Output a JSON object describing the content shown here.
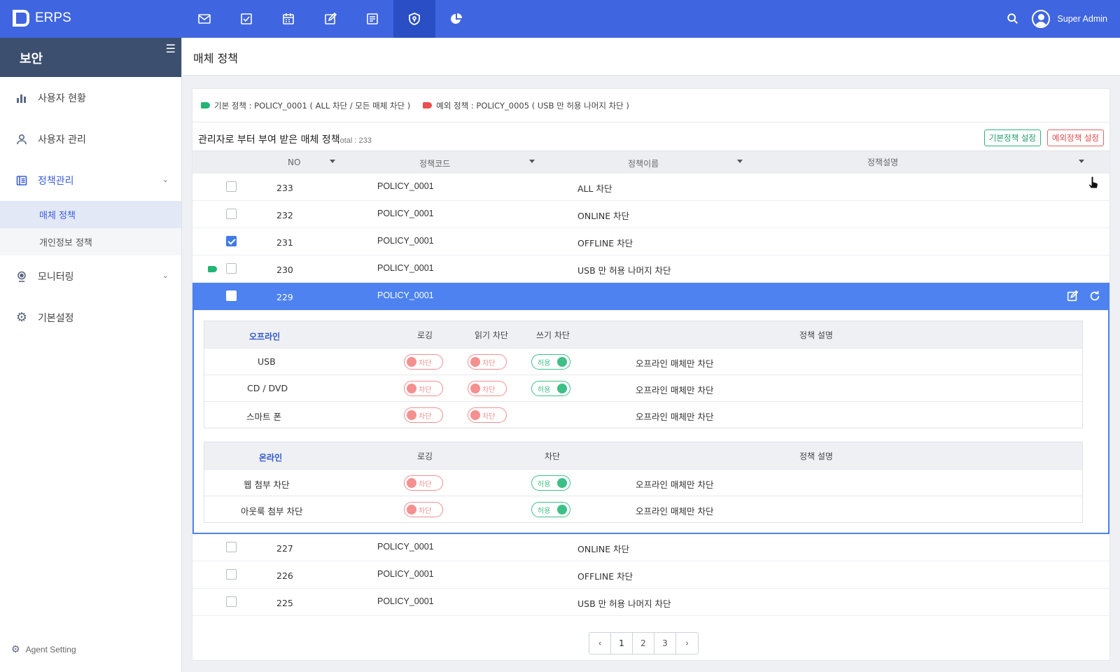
{
  "app": {
    "name": "ERPS",
    "user": "Super Admin"
  },
  "nav_icons": [
    "mail-icon",
    "check-square-icon",
    "calendar-icon",
    "edit-icon",
    "document-icon",
    "shield-icon",
    "pie-chart-icon"
  ],
  "sidebar": {
    "title": "보안",
    "items": [
      {
        "label": "사용자 현황",
        "icon": "bar-chart-icon"
      },
      {
        "label": "사용자 관리",
        "icon": "user-icon"
      },
      {
        "label": "정책관리",
        "icon": "policy-book-icon"
      },
      {
        "label": "모니터링",
        "icon": "webcam-icon"
      },
      {
        "label": "기본설정",
        "icon": "gear-icon"
      }
    ],
    "subitems": [
      {
        "label": "매체 정책"
      },
      {
        "label": "개인정보 정책"
      }
    ],
    "agent_setting": "Agent Setting"
  },
  "page": {
    "title": "매체 정책"
  },
  "legend": {
    "default_policy": "기본 정책 : POLICY_0001 ( ALL 차단 / 모든 매체 차단 )",
    "exception_policy": "예외 정책 : POLICY_0005 ( USB 만 허용 나머지 차단 )"
  },
  "toolbar": {
    "title": "관리자로 부터 부여 받은 매체 정책",
    "total": "otal : 233",
    "btn_default": "기본정책 설정",
    "btn_exception": "예외정책 설정"
  },
  "table": {
    "headers": [
      "NO",
      "정책코드",
      "정책이름",
      "정책설명"
    ],
    "rows_top": [
      {
        "no": "233",
        "code": "POLICY_0001",
        "name": "ALL 차단",
        "checked": false
      },
      {
        "no": "232",
        "code": "POLICY_0001",
        "name": "ONLINE 차단",
        "checked": false
      },
      {
        "no": "231",
        "code": "POLICY_0001",
        "name": "OFFLINE 차단",
        "checked": true
      },
      {
        "no": "230",
        "code": "POLICY_0001",
        "name": "USB 만 허용 나머지 차단",
        "checked": false
      }
    ],
    "selected_row": {
      "no": "229",
      "code": "POLICY_0001"
    },
    "rows_bottom": [
      {
        "no": "227",
        "code": "POLICY_0001",
        "name": "ONLINE 차단"
      },
      {
        "no": "226",
        "code": "POLICY_0001",
        "name": "OFFLINE 차단"
      },
      {
        "no": "225",
        "code": "POLICY_0001",
        "name": "USB 만 허용 나머지 차단"
      }
    ]
  },
  "offline": {
    "section": "오프라인",
    "headers": [
      "로깅",
      "읽기 차단",
      "쓰기 차단",
      "정책 설명"
    ],
    "rows": [
      {
        "device": "USB",
        "logging": "차단",
        "read": "차단",
        "write": "허용",
        "desc": "오프라인 매체만 차단"
      },
      {
        "device": "CD / DVD",
        "logging": "차단",
        "read": "차단",
        "write": "허용",
        "desc": "오프라인 매체만 차단"
      },
      {
        "device": "스마트 폰",
        "logging": "차단",
        "read": "차단",
        "desc": "오프라인 매체만 차단"
      }
    ]
  },
  "online": {
    "section": "온라인",
    "headers": [
      "로깅",
      "차단",
      "정책 설명"
    ],
    "rows": [
      {
        "device": "웹 첨부 차단",
        "logging": "차단",
        "block": "허용",
        "desc": "오프라인 매체만 차단"
      },
      {
        "device": "아웃룩 첨부 차단",
        "logging": "차단",
        "block": "허용",
        "desc": "오프라인 매체만 차단"
      }
    ]
  },
  "pagination": {
    "pages": [
      "1",
      "2",
      "3"
    ],
    "current": "1",
    "prev": "‹",
    "next": "›"
  },
  "colors": {
    "topbar": "#3f66e0",
    "selected_row": "#4d82f0",
    "tag_default": "#22b573",
    "tag_exception": "#ee4d4d"
  }
}
